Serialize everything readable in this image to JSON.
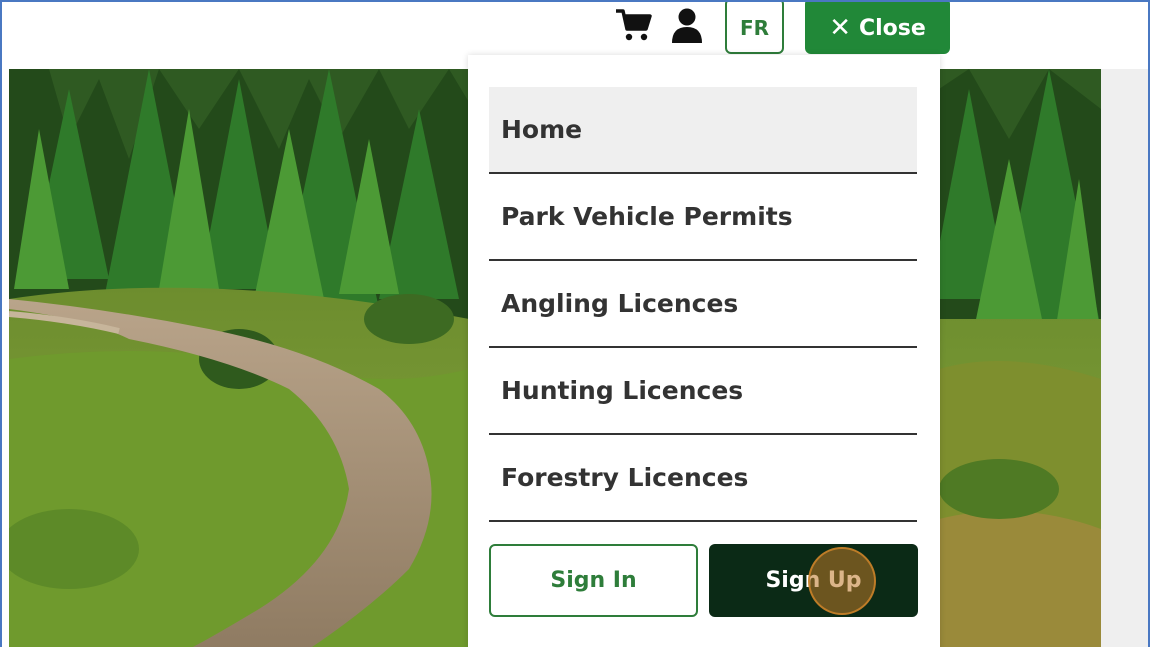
{
  "header": {
    "language_label": "FR",
    "close_label": "Close",
    "close_icon_glyph": "✕",
    "icons": [
      "cart-icon",
      "user-icon",
      "close-icon"
    ]
  },
  "menu": {
    "items": [
      {
        "label": "Home",
        "active": true
      },
      {
        "label": "Park Vehicle Permits",
        "active": false
      },
      {
        "label": "Angling Licences",
        "active": false
      },
      {
        "label": "Hunting Licences",
        "active": false
      },
      {
        "label": "Forestry Licences",
        "active": false
      }
    ],
    "sign_in_label": "Sign In",
    "sign_up_label": "Sign Up"
  },
  "colors": {
    "brand_green": "#218838",
    "outline_green": "#2e7d3a",
    "dark_green": "#0b2a16",
    "active_item_bg": "#efefef",
    "frame_border": "#4a78c2"
  }
}
